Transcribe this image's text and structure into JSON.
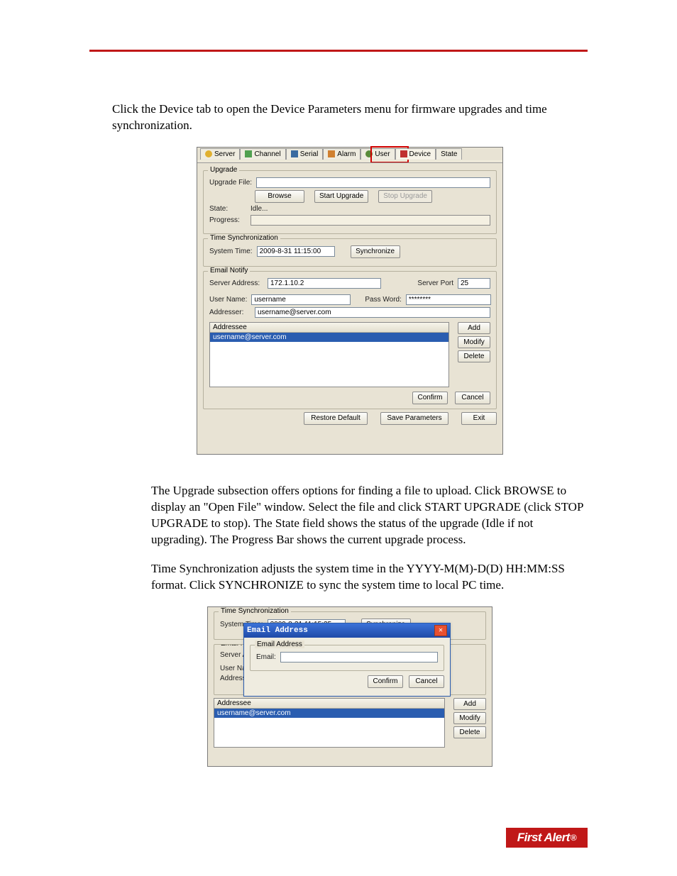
{
  "paragraphs": {
    "p1": "Click the Device tab to open the Device Parameters menu for firmware upgrades and time synchronization.",
    "p2": "The Upgrade subsection offers options for finding a file to upload. Click BROWSE to display an \"Open File\" window. Select the file and click START UPGRADE (click STOP UPGRADE to stop). The State field shows the status of the upgrade (Idle if not upgrading). The Progress Bar shows the current upgrade process.",
    "p3": "Time Synchronization adjusts the system time in the YYYY-M(M)-D(D) HH:MM:SS format. Click SYNCHRONIZE to sync the system time to local PC time."
  },
  "tabs": [
    "Server",
    "Channel",
    "Serial",
    "Alarm",
    "User",
    "Device",
    "State"
  ],
  "upgrade": {
    "group": "Upgrade",
    "file_label": "Upgrade File:",
    "file_value": "",
    "browse": "Browse",
    "start": "Start Upgrade",
    "stop": "Stop Upgrade",
    "state_label": "State:",
    "state_value": "Idle...",
    "progress_label": "Progress:"
  },
  "timesync": {
    "group": "Time Synchronization",
    "label": "System Time:",
    "value": "2009-8-31 11:15:00",
    "value2": "2009-8-31 11:15:25",
    "btn": "Synchronize"
  },
  "email": {
    "group": "Email Notify",
    "server_addr_label": "Server Address:",
    "server_addr": "172.1.10.2",
    "server_port_label": "Server Port",
    "server_port": "25",
    "user_label": "User Name:",
    "user": "username",
    "pass_label": "Pass Word:",
    "pass": "********",
    "addresser_label": "Addresser:",
    "addresser": "username@server.com",
    "list_header": "Addressee",
    "list_item": "username@server.com",
    "add": "Add",
    "modify": "Modify",
    "delete": "Delete"
  },
  "footer_btns": {
    "confirm": "Confirm",
    "cancel": "Cancel",
    "restore": "Restore Default",
    "save": "Save Parameters",
    "exit": "Exit"
  },
  "dialog": {
    "title": "Email Address",
    "group": "Email Address",
    "label": "Email:",
    "value": "",
    "confirm": "Confirm",
    "cancel": "Cancel"
  },
  "logo": "First Alert"
}
